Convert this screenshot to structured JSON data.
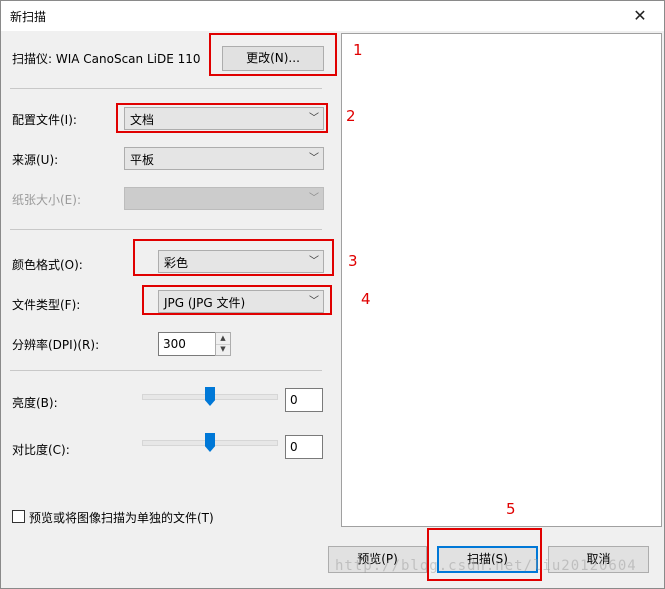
{
  "window": {
    "title": "新扫描",
    "close_glyph": "✕"
  },
  "scanner": {
    "label": "扫描仪: WIA CanoScan LiDE 110",
    "change_button": "更改(N)..."
  },
  "profile": {
    "label": "配置文件(I):",
    "value": "文档"
  },
  "source": {
    "label": "来源(U):",
    "value": "平板"
  },
  "paper_size": {
    "label": "纸张大小(E):",
    "value": ""
  },
  "color_format": {
    "label": "颜色格式(O):",
    "value": "彩色"
  },
  "file_type": {
    "label": "文件类型(F):",
    "value": "JPG (JPG 文件)"
  },
  "resolution": {
    "label": "分辨率(DPI)(R):",
    "value": "300"
  },
  "brightness": {
    "label": "亮度(B):",
    "value": "0",
    "level": 0
  },
  "contrast": {
    "label": "对比度(C):",
    "value": "0",
    "level": 0
  },
  "separate_files": {
    "label": "预览或将图像扫描为单独的文件(T)",
    "checked": false
  },
  "buttons": {
    "preview": "预览(P)",
    "scan": "扫描(S)",
    "cancel": "取消"
  },
  "annotations": [
    "1",
    "2",
    "3",
    "4",
    "5"
  ],
  "watermark": "http://blog.csdn.net/liu20120604",
  "colors": {
    "annotation": "#e00000",
    "slider_thumb": "#0078d7",
    "default_button_border": "#0078d7"
  },
  "icons": {
    "dropdown": "chevron-down-icon",
    "spin_up": "spin-up-icon",
    "spin_down": "spin-down-icon",
    "close": "close-icon"
  }
}
